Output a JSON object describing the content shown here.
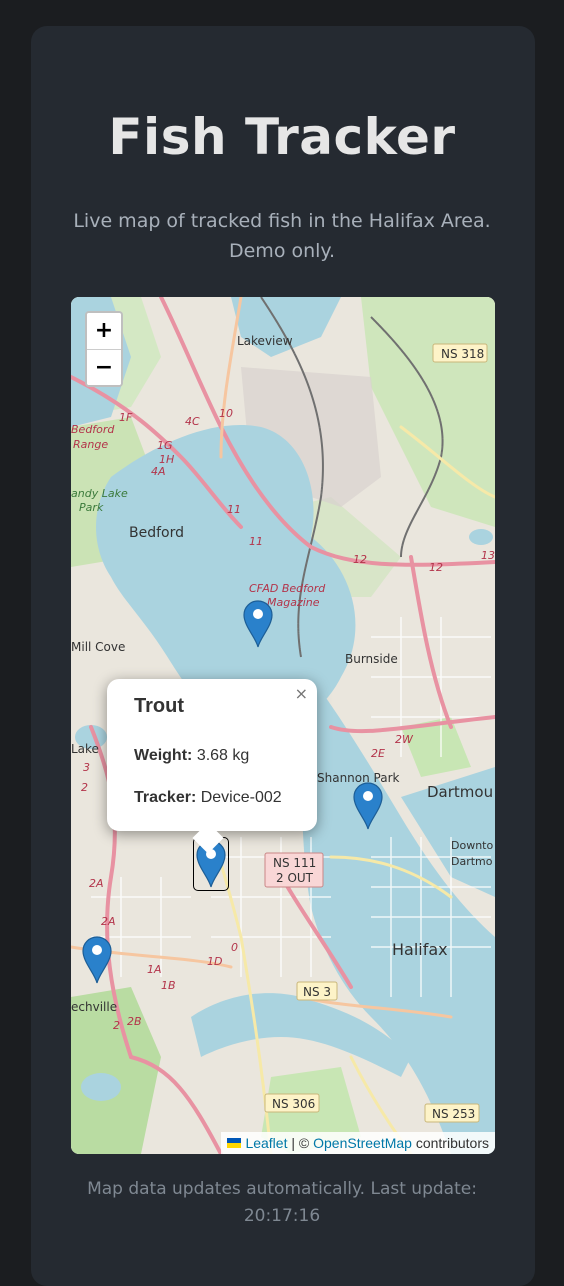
{
  "page": {
    "title": "Fish Tracker",
    "subtitle": "Live map of tracked fish in the Halifax Area. Demo only.",
    "footer": "Map data updates automatically. Last update: 20:17:16"
  },
  "map": {
    "zoom_in": "+",
    "zoom_out": "−",
    "labels": {
      "lakeview": "Lakeview",
      "bedford": "Bedford",
      "bedford_range_1": "Bedford",
      "bedford_range_2": "Range",
      "sandy_lake_1": "andy Lake",
      "sandy_lake_2": "Park",
      "cfad_1": "CFAD Bedford",
      "cfad_2": "Magazine",
      "mill_cove": "Mill Cove",
      "burnside": "Burnside",
      "lake": "Lake",
      "shannon_park": "Shannon Park",
      "dartmouth": "Dartmou",
      "downtown_1": "Downto",
      "downtown_2": "Dartmo",
      "halifax": "Halifax",
      "beechville": "echville",
      "ns318": "NS 318",
      "ns111_1": "NS 111",
      "ns111_2": "2 OUT",
      "ns3": "NS 3",
      "ns306": "NS 306",
      "ns253": "NS 253",
      "r1f": "1F",
      "r4c": "4C",
      "r10": "10",
      "r1g": "1G",
      "r1h": "1H",
      "r4a": "4A",
      "r11a": "11",
      "r11b": "11",
      "r12a": "12",
      "r12b": "12",
      "r13": "13",
      "r2e": "2E",
      "r2w": "2W",
      "r3": "3",
      "r2": "2",
      "r2a": "2A",
      "r2a2": "2A",
      "r1d": "1D",
      "r0": "0",
      "r1a": "1A",
      "r1b": "1B",
      "r2b": "2B",
      "r2c": "2"
    },
    "popup": {
      "title": "Trout",
      "weight_label": "Weight:",
      "weight_value": "3.68 kg",
      "tracker_label": "Tracker:",
      "tracker_value": "Device-002",
      "close": "×"
    },
    "attribution": {
      "leaflet": "Leaflet",
      "separator": " | © ",
      "osm": "OpenStreetMap",
      "suffix": " contributors"
    },
    "colors": {
      "water": "#aad3df",
      "land": "#eae6dd",
      "park": "#c8e6b4",
      "primary_road": "#f6c6a0",
      "motorway": "#e892a2",
      "marker": "#2a81cb",
      "label_red": "#b3344a"
    }
  }
}
